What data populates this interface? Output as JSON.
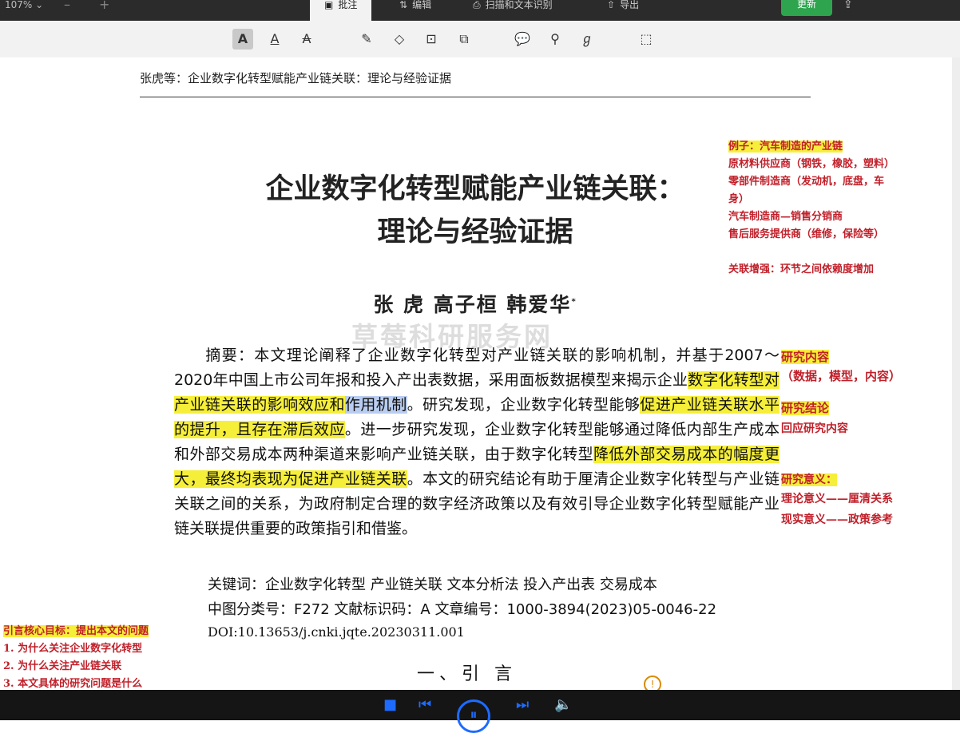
{
  "topbar": {
    "zoom": "107% ⌄",
    "zoom_minus": "–",
    "zoom_plus": "+",
    "tabs": [
      {
        "label": "批注",
        "icon": "annotate-icon"
      },
      {
        "label": "编辑",
        "icon": "edit-icon"
      },
      {
        "label": "扫描和文本识别",
        "icon": "scan-icon"
      },
      {
        "label": "导出",
        "icon": "export-icon"
      }
    ],
    "update_label": "更新"
  },
  "toolbar": {
    "tools": [
      "highlight-text",
      "underline-text",
      "strikethrough-text",
      "pen",
      "eraser",
      "textbox",
      "shapes",
      "comment",
      "stamp",
      "signature",
      "select-area"
    ]
  },
  "document": {
    "running_head": "张虎等：企业数字化转型赋能产业链关联：理论与经验证据",
    "title_line1": "企业数字化转型赋能产业链关联：",
    "title_line2": "理论与经验证据",
    "authors": "张  虎   高子桓   韩爱华",
    "author_mark": "*",
    "watermark": "草莓科研服务网",
    "abstract": {
      "p1": "摘要：本文理论阐释了企业数字化转型对产业链关联的影响机制，并基于2007～2020年中国上市公司年报和投入产出表数据，采用面板数据模型来揭示企业",
      "hl1": "数字化转型对产业链关联的影响效应和",
      "sel1": "作用机制",
      "p2": "。研究发现，企业数字化转型能够",
      "hl2": "促进产业链关联水平的提升，且存在滞后效应",
      "p3": "。进一步研究发现，企业数字化转型能够通过降低内部生产成本和外部交易成本两种渠道来影响产业链关联，由于数字化转型",
      "hl3": "降低外部交易成本的幅度更大，最终均表现为促进产业链关联",
      "p4": "。本文的研究结论有助于厘清企业数字化转型与产业链关联之间的关系，为政府制定合理的数字经济政策以及有效引导企业数字化转型赋能产业链关联提供重要的政策指引和借鉴。"
    },
    "keywords": "关键词：企业数字化转型   产业链关联   文本分析法   投入产出表   交易成本",
    "classification": "中图分类号：F272   文献标识码：A   文章编号：1000-3894(2023)05-0046-22",
    "doi": "DOI:10.13653/j.cnki.jqte.20230311.001",
    "section_heading": "一、引  言"
  },
  "notes": {
    "right_top": [
      "例子：汽车制造的产业链",
      "原材料供应商（钢铁，橡胶，塑料）",
      "零部件制造商（发动机，底盘，车",
      "身）",
      "汽车制造商—销售分销商",
      "售后服务提供商（维修，保险等）",
      "",
      "关联增强：环节之间依赖度增加"
    ],
    "research_content": "研究内容",
    "research_content_detail": "（数据，模型，内容）",
    "research_conclusion": "研究结论",
    "reply_content": "回应研究内容",
    "research_significance": "研究意义：",
    "theory": "理论意义——厘清关系",
    "practice": "现实意义——政策参考",
    "intro_goal": "引言核心目标：提出本文的问题",
    "q1": "1.  为什么关注企业数字化转型",
    "q2": "2.  为什么关注产业链关联",
    "q3": "3.  本文具体的研究问题是什么"
  },
  "player": {
    "stop": "■",
    "prev": "⏮",
    "pause": "⏸",
    "next": "⏭",
    "volume": "🔈"
  }
}
